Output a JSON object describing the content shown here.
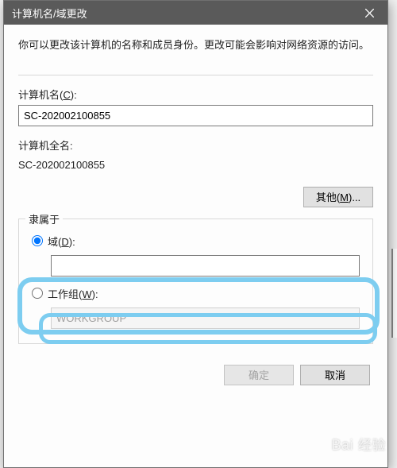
{
  "window": {
    "title": "计算机名/域更改"
  },
  "description": "你可以更改该计算机的名称和成员身份。更改可能会影响对网络资源的访问。",
  "computer_name": {
    "label_prefix": "计算机名(",
    "label_hotkey": "C",
    "label_suffix": "):",
    "value": "SC-202002100855"
  },
  "full_name": {
    "label": "计算机全名:",
    "value": "SC-202002100855"
  },
  "buttons": {
    "other_prefix": "其他(",
    "other_hotkey": "M",
    "other_suffix": ")...",
    "ok": "确定",
    "cancel": "取消"
  },
  "member_of": {
    "legend": "隶属于",
    "domain": {
      "label_prefix": "域(",
      "label_hotkey": "D",
      "label_suffix": "):",
      "value": "",
      "checked": true
    },
    "workgroup": {
      "label_prefix": "工作组(",
      "label_hotkey": "W",
      "label_suffix": "):",
      "value": "WORKGROUP",
      "checked": false
    }
  },
  "watermark": {
    "brand_en": "Bai",
    "brand_cn": "经验"
  }
}
